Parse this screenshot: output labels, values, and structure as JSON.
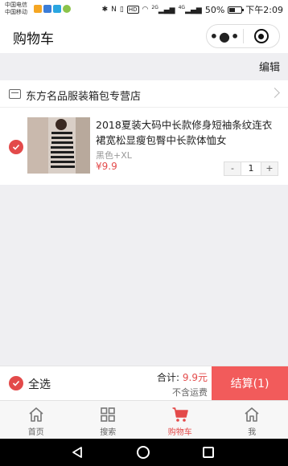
{
  "status_bar": {
    "carrier_1": "中国电信",
    "carrier_2": "中国移动",
    "nfc": "N",
    "hd": "HD",
    "net_1": "2G",
    "net_2": "4G",
    "battery_percent": "50%",
    "battery_level": 0.5,
    "time": "下午2:09"
  },
  "nav": {
    "title": "购物车",
    "more_glyph": "•●•"
  },
  "cart": {
    "edit_label": "编辑",
    "shop_name": "东方名品服装箱包专营店",
    "item": {
      "title": "2018夏装大码中长款修身短袖条纹连衣裙宽松显瘦包臀中长款体恤女",
      "spec": "黑色+XL",
      "price": "¥9.9",
      "quantity": "1",
      "minus": "-",
      "plus": "+",
      "selected": true
    }
  },
  "checkout": {
    "select_all_label": "全选",
    "total_label": "合计:",
    "total_amount": "9.9元",
    "shipping_note": "不含运费",
    "settle_label": "结算(1)"
  },
  "tabs": [
    {
      "label": "首页",
      "icon": "home-icon"
    },
    {
      "label": "搜索",
      "icon": "grid-icon"
    },
    {
      "label": "购物车",
      "icon": "cart-icon"
    },
    {
      "label": "我",
      "icon": "home-icon"
    }
  ],
  "colors": {
    "accent": "#e34a4a",
    "settle_button": "#f25b5b",
    "background": "#efeff2"
  }
}
